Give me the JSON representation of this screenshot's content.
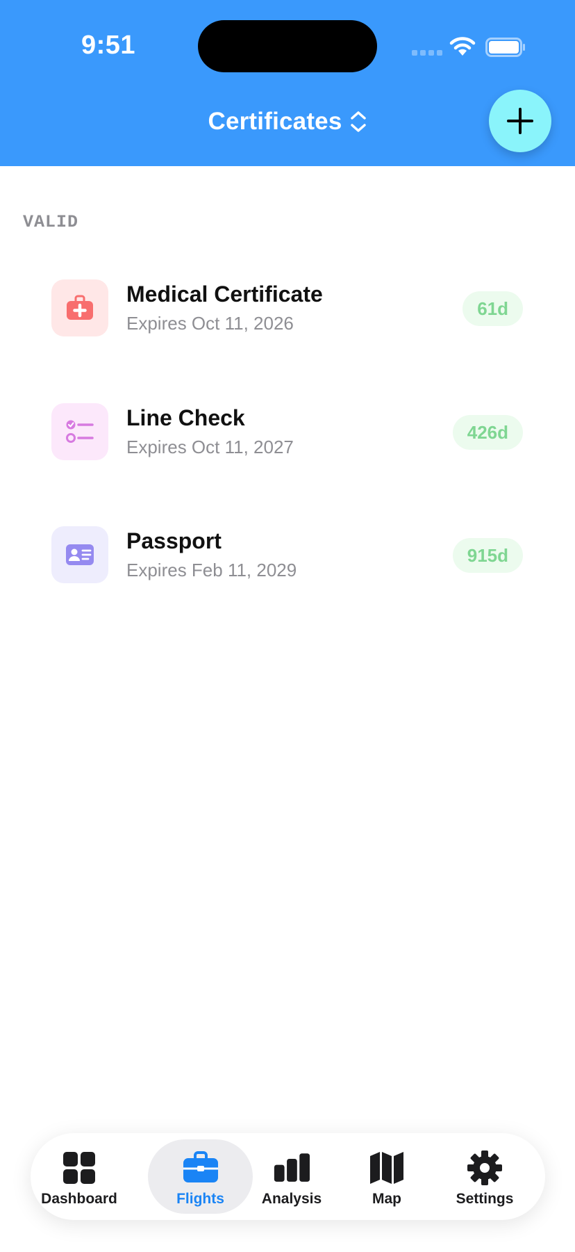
{
  "status_bar": {
    "time": "9:51"
  },
  "header": {
    "title": "Certificates",
    "add_icon": "plus-icon",
    "title_icon": "chevron-up-down-icon"
  },
  "section": {
    "label": "VALID"
  },
  "certificates": [
    {
      "title": "Medical Certificate",
      "subtitle": "Expires Oct 11, 2026",
      "badge": "61d",
      "icon": "medical-kit-icon",
      "icon_bg": "#ffe7e7",
      "icon_color": "#f86e6e"
    },
    {
      "title": "Line Check",
      "subtitle": "Expires Oct 11, 2027",
      "badge": "426d",
      "icon": "checklist-icon",
      "icon_bg": "#fce8fb",
      "icon_color": "#d77ae0"
    },
    {
      "title": "Passport",
      "subtitle": "Expires Feb 11, 2029",
      "badge": "915d",
      "icon": "id-card-icon",
      "icon_bg": "#eeedfd",
      "icon_color": "#958af0"
    }
  ],
  "badge_colors": {
    "bg": "#ecfbee",
    "text": "#7fd692"
  },
  "tabs": [
    {
      "label": "Dashboard",
      "icon": "grid-icon",
      "active": false
    },
    {
      "label": "Flights",
      "icon": "briefcase-icon",
      "active": true
    },
    {
      "label": "Analysis",
      "icon": "bar-chart-icon",
      "active": false
    },
    {
      "label": "Map",
      "icon": "map-icon",
      "active": false
    },
    {
      "label": "Settings",
      "icon": "gear-icon",
      "active": false
    }
  ],
  "colors": {
    "header": "#3a99fc",
    "fab": "#8af4fb",
    "active_tab": "#1a84f5"
  }
}
